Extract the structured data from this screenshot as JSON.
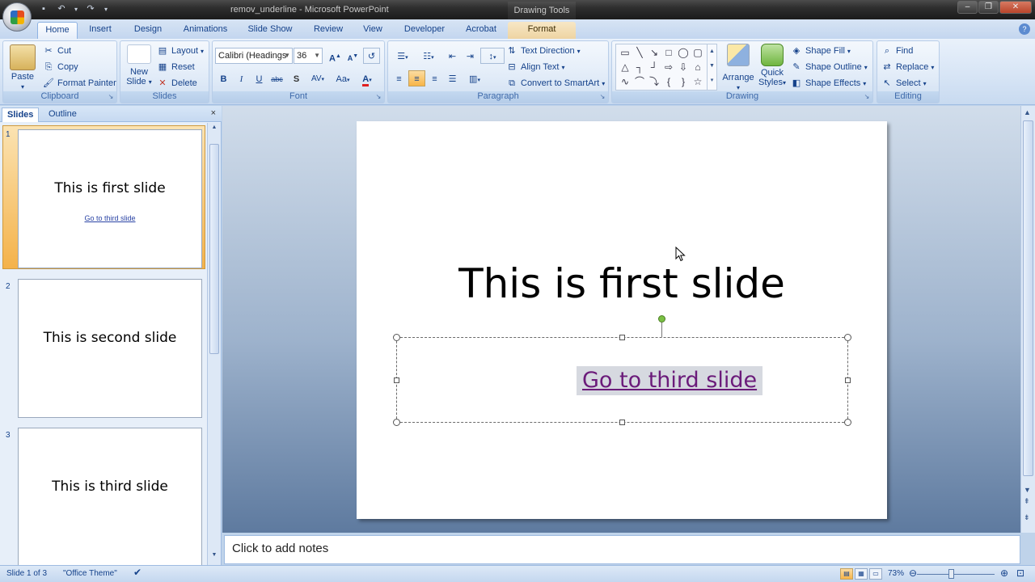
{
  "titlebar": {
    "document_title": "remov_underline - Microsoft PowerPoint",
    "contextual_tab_group": "Drawing Tools"
  },
  "tabs": [
    "Home",
    "Insert",
    "Design",
    "Animations",
    "Slide Show",
    "Review",
    "View",
    "Developer",
    "Acrobat",
    "Format"
  ],
  "active_tab": "Home",
  "clipboard": {
    "paste": "Paste",
    "cut": "Cut",
    "copy": "Copy",
    "format_painter": "Format Painter",
    "label": "Clipboard"
  },
  "slides_group": {
    "new_slide_line1": "New",
    "new_slide_line2": "Slide",
    "layout": "Layout",
    "reset": "Reset",
    "delete": "Delete",
    "label": "Slides"
  },
  "font": {
    "font_name": "Calibri (Headings",
    "font_size": "36",
    "bold": "B",
    "italic": "I",
    "underline": "U",
    "strike": "abc",
    "shadow": "S",
    "spacing": "AV",
    "case": "Aa",
    "color": "A",
    "grow": "A",
    "shrink": "A",
    "label": "Font"
  },
  "paragraph": {
    "text_direction": "Text Direction",
    "align_text": "Align Text",
    "convert_smartart": "Convert to SmartArt",
    "label": "Paragraph"
  },
  "drawing": {
    "arrange": "Arrange",
    "quick_styles_line1": "Quick",
    "quick_styles_line2": "Styles",
    "shape_fill": "Shape Fill",
    "shape_outline": "Shape Outline",
    "shape_effects": "Shape Effects",
    "label": "Drawing"
  },
  "editing": {
    "find": "Find",
    "replace": "Replace",
    "select": "Select",
    "label": "Editing"
  },
  "pane": {
    "tab_slides": "Slides",
    "tab_outline": "Outline",
    "close": "×"
  },
  "thumbnails": [
    {
      "number": "1",
      "title": "This is first slide",
      "link": "Go to third slide"
    },
    {
      "number": "2",
      "title": "This is second slide"
    },
    {
      "number": "3",
      "title": "This is third slide"
    }
  ],
  "slide": {
    "title": "This is first slide",
    "link": "Go to third slide"
  },
  "notes": {
    "placeholder": "Click to add notes"
  },
  "status": {
    "slide_position": "Slide 1 of 3",
    "theme": "\"Office Theme\"",
    "zoom": "73%"
  },
  "colors": {
    "accent": "#15428b",
    "link": "#6b1b7a",
    "ribbon": "#d6e4f5",
    "selected_thumb": "#f4b24a"
  }
}
